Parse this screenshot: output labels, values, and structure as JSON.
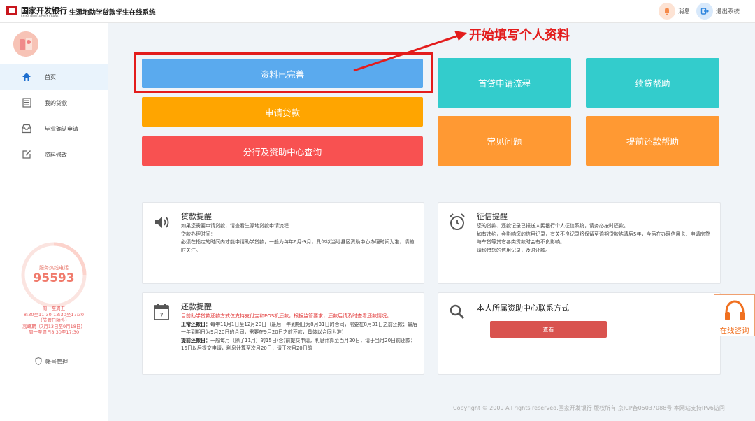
{
  "header": {
    "logo_cn": "国家开发银行",
    "logo_en": "CHINA DEVELOPMENT BANK",
    "system_title": "生源地助学贷款学生在线系统",
    "messages_label": "消息",
    "logout_label": "退出系统"
  },
  "sidebar": {
    "items": [
      {
        "label": "首页",
        "icon": "home-icon",
        "active": true
      },
      {
        "label": "我的贷款",
        "icon": "document-icon",
        "active": false
      },
      {
        "label": "毕业确认申请",
        "icon": "inbox-icon",
        "active": false
      },
      {
        "label": "资料修改",
        "icon": "edit-icon",
        "active": false
      }
    ],
    "hotline_caption": "服务热线电话",
    "hotline_number": "95593",
    "hours": [
      "周一至周五",
      "8:30至11:30-13:30至17:30",
      "（节假日除外）",
      "高峰期（7月13日至9月18日）",
      "周一至周日8:30至17:30"
    ],
    "account_label": "帐号管理"
  },
  "tiles": {
    "profile_complete": "资料已完善",
    "apply_loan": "申请贷款",
    "branch_query": "分行及资助中心查询",
    "first_loan_process": "首贷申请流程",
    "renewal_help": "续贷帮助",
    "faq": "常见问题",
    "early_repay_help": "提前还款帮助"
  },
  "annotation": "开始填写个人资料",
  "cards": {
    "loan_reminder": {
      "title": "贷款提醒",
      "lines": [
        "如果您需要申请贷款，请查看生源地贷款申请流程",
        "贷款办理时间：",
        "必须在指定的时间内才能申请助学贷款，一般为每年6月-9月，具体以当地县区资助中心办理时间为准，请随时关注。"
      ]
    },
    "credit_reminder": {
      "title": "征信提醒",
      "lines": [
        "您的贷款、还款记录已报送人民银行个人征信系统，请务必按时还款。",
        "如有违约，会影响您的信用记录，有关不良记录将保留至逾期贷款结清后5年，今后在办理信用卡、申请房贷与车贷等其它各类贷款时会有不良影响。",
        "请珍惜您的信用记录，及时还款。"
      ]
    },
    "repay_reminder": {
      "title": "还款提醒",
      "notice": "目前助学贷款还款方式仅支持支付宝和POS机还款，根据监管要求，还款后请及时查看还款情况。",
      "normal_label": "正常还款日：",
      "normal_text": "每年11月1日至12月20日（最后一年到期日为8月31日的合同，需要在8月31日之前还款；最后一年到期日为9月20日的合同，需要在9月20日之前还款，具体以合同为准）",
      "early_label": "提前还款日：",
      "early_text": "一般每月（除了11月）的15日(含)前提交申请，利息计算至当月20日，请于当月20日前还款；16日以后提交申请，利息计算至次月20日，请于次月20日前"
    },
    "center_contact": {
      "title": "本人所属资助中心联系方式",
      "button": "查看"
    }
  },
  "consult_label": "在线咨询",
  "copyright": "Copyright © 2009 All rights reserved.国家开发银行 版权所有 京ICP备05037088号 本网站支持IPv6访问",
  "colors": {
    "blue_tile": "#5aaaee",
    "orange_tile": "#ffa500",
    "red_tile": "#f85151",
    "teal_tile": "#33cccc",
    "amber_tile": "#ff9933",
    "annotation_red": "#e31c1c"
  }
}
